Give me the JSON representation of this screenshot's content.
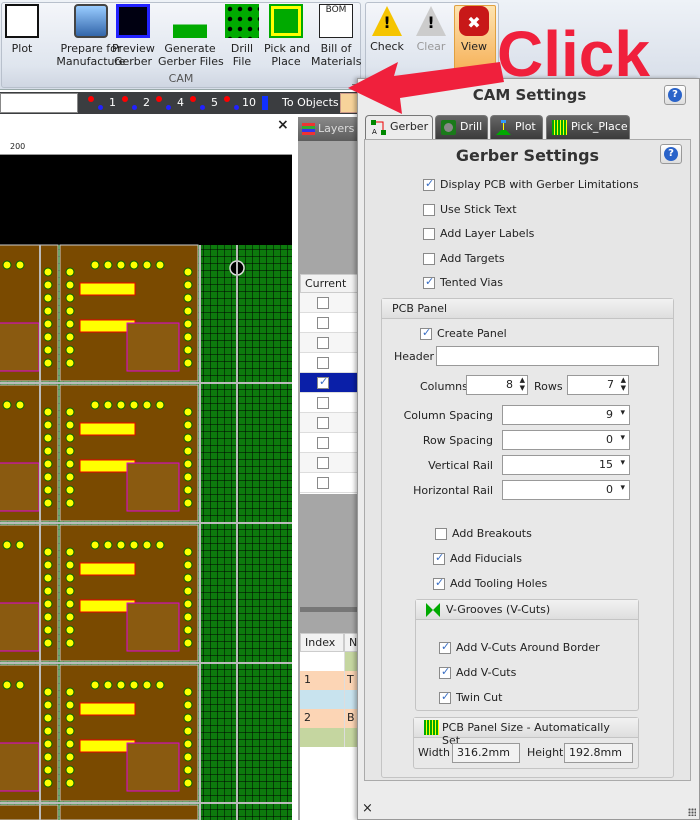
{
  "ribbon": {
    "cam_group_label": "CAM",
    "buttons": [
      {
        "label": "Plot",
        "icon": "plot-icon"
      },
      {
        "label": "Prepare for\nManufacture",
        "icon": "briefcase-icon"
      },
      {
        "label": "Preview\nGerber",
        "icon": "preview-gerber-icon"
      },
      {
        "label": "Generate\nGerber Files",
        "icon": "generate-gerber-icon"
      },
      {
        "label": "Drill\nFile",
        "icon": "drill-file-icon"
      },
      {
        "label": "Pick and\nPlace",
        "icon": "pick-place-icon"
      },
      {
        "label": "Bill of\nMaterials",
        "icon": "bom-icon",
        "icon_text": "BOM"
      }
    ],
    "drc_buttons": [
      {
        "label": "Check",
        "icon": "warning-icon"
      },
      {
        "label": "Clear",
        "icon": "clear-warning-icon"
      },
      {
        "label": "View",
        "icon": "error-x-icon"
      }
    ]
  },
  "toolbar": {
    "grid_buttons": [
      "1",
      "2",
      "4",
      "5",
      "10"
    ],
    "to_objects": "To Objects"
  },
  "canvas": {
    "ruler_label": "200",
    "close": "×"
  },
  "layers_panel": {
    "tab": "Layers",
    "column_current": "Current",
    "rows_checked": [
      false,
      false,
      false,
      false,
      true,
      false,
      false,
      false,
      false,
      false
    ],
    "selected_row": 4
  },
  "lower_table": {
    "headers": [
      "Index",
      "N"
    ],
    "rows": [
      {
        "index": "",
        "name": "",
        "color": "#c5d6a0"
      },
      {
        "index": "1",
        "name": "T",
        "color": "#fcd5b5"
      },
      {
        "index": "",
        "name": "",
        "color": "#c8e3ee"
      },
      {
        "index": "2",
        "name": "B",
        "color": "#fcd5b5"
      },
      {
        "index": "",
        "name": "",
        "color": "#c5d6a0"
      }
    ]
  },
  "dialog": {
    "title": "CAM Settings",
    "tabs": [
      {
        "label": "Gerber",
        "active": true
      },
      {
        "label": "Drill",
        "active": false
      },
      {
        "label": "Plot",
        "active": false
      },
      {
        "label": "Pick_Place",
        "active": false
      }
    ],
    "heading": "Gerber Settings",
    "options": [
      {
        "label": "Display PCB with Gerber Limitations",
        "checked": true
      },
      {
        "label": "Use Stick Text",
        "checked": false
      },
      {
        "label": "Add Layer Labels",
        "checked": false
      },
      {
        "label": "Add Targets",
        "checked": false
      },
      {
        "label": "Tented Vias",
        "checked": true
      }
    ],
    "pcb_panel": {
      "title": "PCB Panel",
      "create_panel": {
        "label": "Create Panel",
        "checked": true
      },
      "header_label": "Header",
      "header_value": "",
      "columns_label": "Columns",
      "columns": "8",
      "rows_label": "Rows",
      "rows": "7",
      "column_spacing_label": "Column Spacing",
      "column_spacing": "9",
      "row_spacing_label": "Row Spacing",
      "row_spacing": "0",
      "vertical_rail_label": "Vertical Rail",
      "vertical_rail": "15",
      "horizontal_rail_label": "Horizontal Rail",
      "horizontal_rail": "0",
      "extras": [
        {
          "label": "Add Breakouts",
          "checked": false
        },
        {
          "label": "Add Fiducials",
          "checked": true
        },
        {
          "label": "Add Tooling Holes",
          "checked": true
        }
      ],
      "vgrooves": {
        "title": "V-Grooves (V-Cuts)",
        "options": [
          {
            "label": "Add V-Cuts Around Border",
            "checked": true
          },
          {
            "label": "Add V-Cuts",
            "checked": true
          },
          {
            "label": "Twin Cut",
            "checked": true
          }
        ]
      },
      "size": {
        "title": "PCB Panel Size - Automatically Set",
        "width_label": "Width",
        "width": "316.2mm",
        "height_label": "Height",
        "height": "192.8mm"
      }
    },
    "close": "×"
  },
  "annotation": {
    "text": "Click",
    "color": "#f0203c"
  },
  "colors": {
    "pcb_green": "#0a6a0a",
    "board_brown": "#7a4a00",
    "selected_row": "#0a1fa8"
  }
}
